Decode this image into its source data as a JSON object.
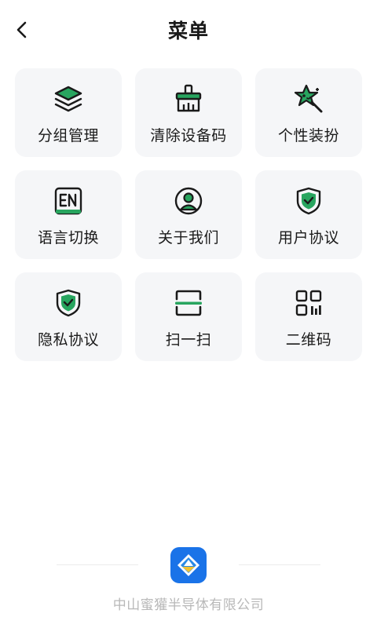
{
  "header": {
    "title": "菜单",
    "back_icon": "chevron-left-icon"
  },
  "colors": {
    "accent": "#28a55f",
    "dark": "#1a1a1a",
    "tile_bg": "#f5f6f8",
    "brand": "#1a73e8"
  },
  "menu": {
    "items": [
      {
        "label": "分组管理",
        "icon": "layers-icon"
      },
      {
        "label": "清除设备码",
        "icon": "broom-icon"
      },
      {
        "label": "个性装扮",
        "icon": "star-wand-icon"
      },
      {
        "label": "语言切换",
        "icon": "language-en-icon"
      },
      {
        "label": "关于我们",
        "icon": "user-circle-icon"
      },
      {
        "label": "用户协议",
        "icon": "shield-check-icon"
      },
      {
        "label": "隐私协议",
        "icon": "shield-check-icon"
      },
      {
        "label": "扫一扫",
        "icon": "scan-icon"
      },
      {
        "label": "二维码",
        "icon": "qr-code-icon"
      }
    ]
  },
  "footer": {
    "company_name": "中山蜜獾半导体有限公司",
    "logo_icon": "company-logo-icon"
  }
}
